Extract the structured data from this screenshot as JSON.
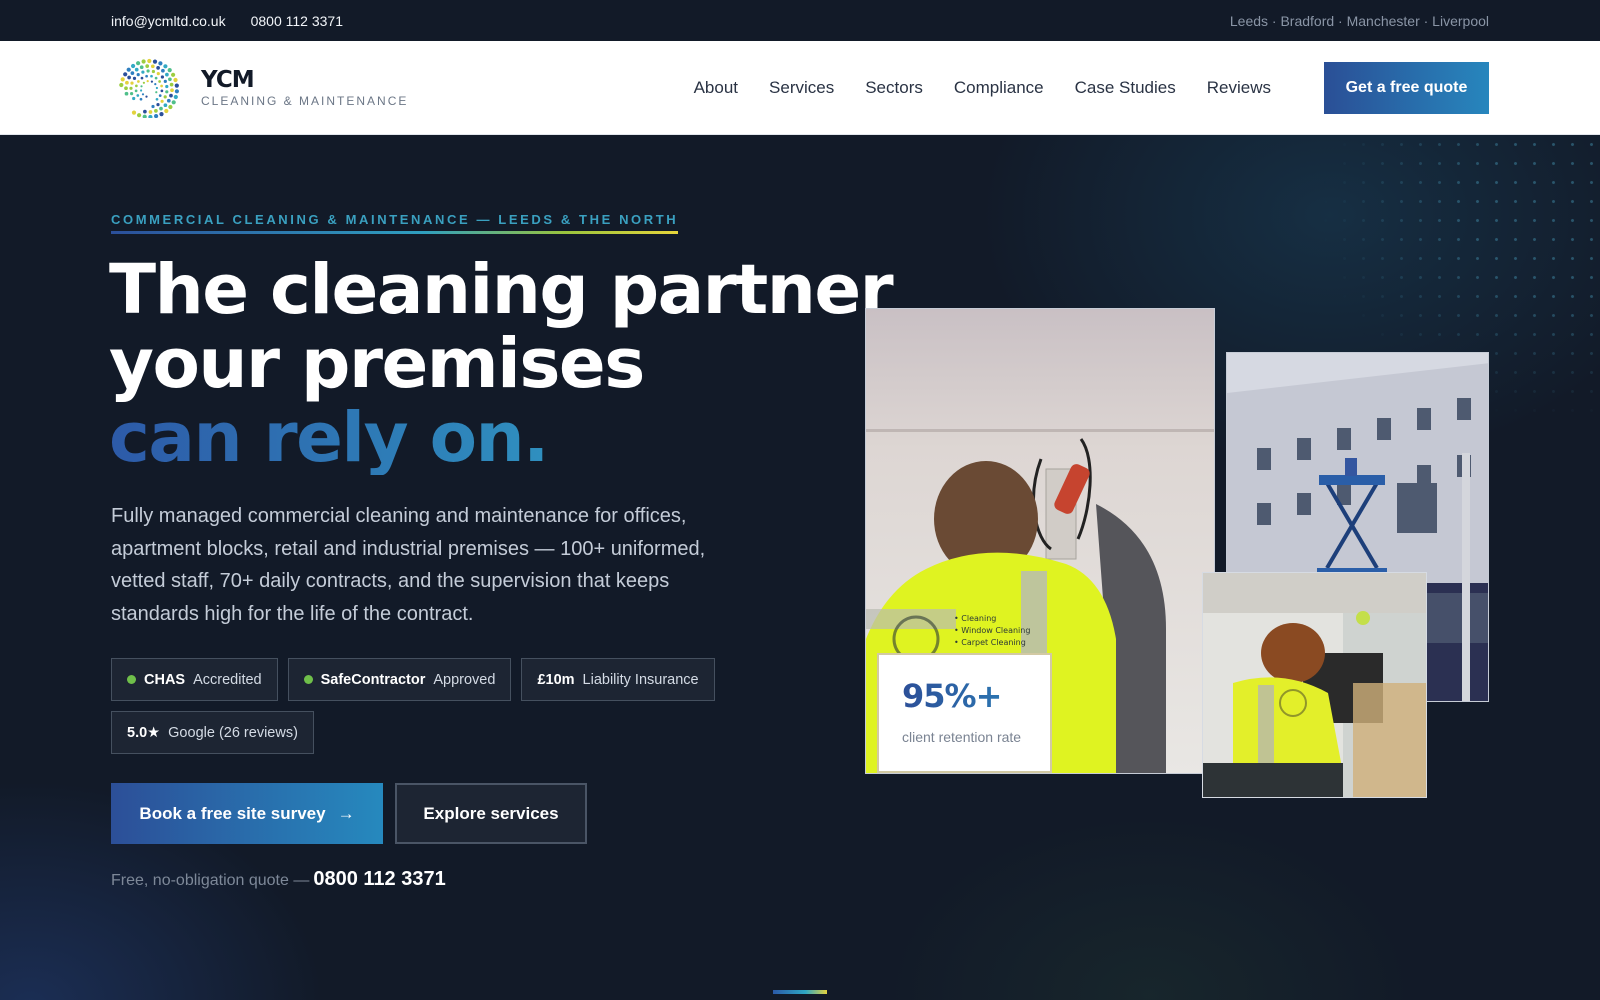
{
  "topbar": {
    "email": "info@ycmltd.co.uk",
    "phone": "0800 112 3371",
    "locations": "Leeds · Bradford · Manchester · Liverpool"
  },
  "header": {
    "logo_icon": "spiral-dots-logo",
    "brand_name": "YCM",
    "brand_tagline": "CLEANING & MAINTENANCE",
    "nav": [
      {
        "label": "About"
      },
      {
        "label": "Services"
      },
      {
        "label": "Sectors"
      },
      {
        "label": "Compliance"
      },
      {
        "label": "Case Studies"
      },
      {
        "label": "Reviews"
      }
    ],
    "cta_label": "Get a free quote"
  },
  "hero": {
    "eyebrow": "COMMERCIAL CLEANING & MAINTENANCE — LEEDS & THE NORTH",
    "headline_line1": "The cleaning partner",
    "headline_line2": "your premises",
    "headline_accent": "can rely on.",
    "lede": "Fully managed commercial cleaning and maintenance for offices, apartment blocks, retail and industrial premises — 100+ uniformed, vetted staff, 70+ daily contracts, and the supervision that keeps standards high for the life of the contract.",
    "badges": [
      {
        "strong": "CHAS",
        "text": "Accredited",
        "has_dot": true
      },
      {
        "strong": "SafeContractor",
        "text": "Approved",
        "has_dot": true
      },
      {
        "strong": "£10m",
        "text": "Liability Insurance",
        "has_dot": false
      },
      {
        "strong": "5.0★",
        "text": "Google (26 reviews)",
        "has_dot": false
      }
    ],
    "primary_cta": "Book a free site survey",
    "primary_cta_icon": "arrow-right",
    "primary_cta_arrow": "→",
    "secondary_cta": "Explore services",
    "quote_note": "Free, no-obligation quote —",
    "quote_phone": "0800 112 3371"
  },
  "stat_card": {
    "value": "95%+",
    "label": "client retention rate"
  },
  "colors": {
    "navy": "#121a28",
    "accent_blue": "#2c4f98",
    "accent_teal": "#2786bd",
    "eyebrow_teal": "#3aa0c0",
    "badge_dot_green": "#6fbf4a"
  }
}
